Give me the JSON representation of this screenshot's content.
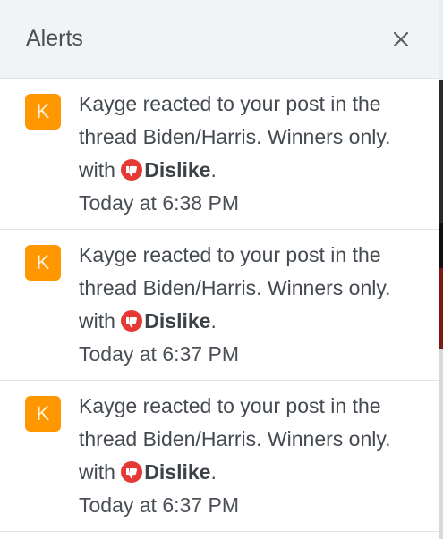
{
  "header": {
    "title": "Alerts",
    "close_icon": "close-icon"
  },
  "alerts": [
    {
      "avatar_letter": "K",
      "user": "Kayge",
      "action": "reacted to your post in the thread",
      "thread": "Biden/Harris. Winners only.",
      "with": "with",
      "reaction": "Dislike",
      "period": ".",
      "time": "Today at 6:38 PM"
    },
    {
      "avatar_letter": "K",
      "user": "Kayge",
      "action": "reacted to your post in the thread",
      "thread": "Biden/Harris. Winners only.",
      "with": "with",
      "reaction": "Dislike",
      "period": ".",
      "time": "Today at 6:37 PM"
    },
    {
      "avatar_letter": "K",
      "user": "Kayge",
      "action": "reacted to your post in the thread",
      "thread": "Biden/Harris. Winners only.",
      "with": "with",
      "reaction": "Dislike",
      "period": ".",
      "time": "Today at 6:37 PM"
    }
  ],
  "colors": {
    "avatar_bg": "#ff9800",
    "dislike_icon": "#e53935",
    "header_bg": "#f1f3f5"
  }
}
